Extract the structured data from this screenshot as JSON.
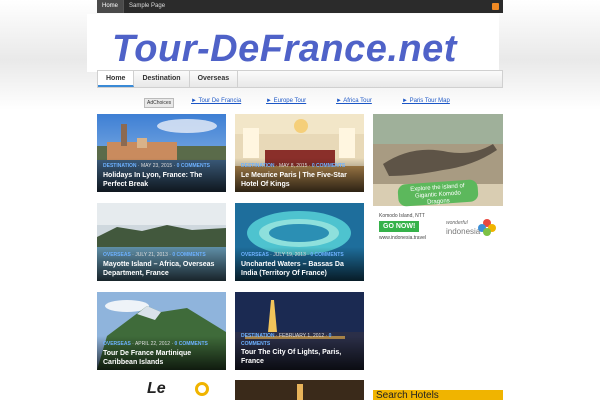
{
  "topbar": {
    "items": [
      {
        "label": "Home"
      },
      {
        "label": "Sample Page"
      }
    ]
  },
  "header": {
    "logo": "Tour-DeFrance.net"
  },
  "nav": {
    "items": [
      {
        "label": "Home"
      },
      {
        "label": "Destination"
      },
      {
        "label": "Overseas"
      }
    ]
  },
  "ad_links": {
    "adchoices": "AdChoices",
    "links": [
      "► Tour De Francia",
      "► Europe Tour",
      "► Africa Tour",
      "► Paris Tour Map"
    ]
  },
  "posts": [
    {
      "category": "DESTINATION",
      "date": "MAY 23, 2015",
      "comments": "0 COMMENTS",
      "title": "Holidays In Lyon, France: The Perfect Break"
    },
    {
      "category": "DESTINATION",
      "date": "MAY 8, 2015",
      "comments": "0 COMMENTS",
      "title": "Le Meurice Paris | The Five-Star Hotel Of Kings"
    },
    {
      "category": "OVERSEAS",
      "date": "JULY 21, 2013",
      "comments": "0 COMMENTS",
      "title": "Mayotte Island – Africa, Overseas Department, France"
    },
    {
      "category": "OVERSEAS",
      "date": "JULY 19, 2013",
      "comments": "0 COMMENTS",
      "title": "Uncharted Waters – Bassas Da India (Territory Of France)"
    },
    {
      "category": "OVERSEAS",
      "date": "APRIL 22, 2012",
      "comments": "0 COMMENTS",
      "title": "Tour De France Martinique Caribbean Islands"
    },
    {
      "category": "DESTINATION",
      "date": "FEBRUARY 1, 2012",
      "comments": "0 COMMENTS",
      "title": "Tour The City Of Lights, Paris, France"
    }
  ],
  "ad": {
    "headline": "Explore the island of Gigantic Komodo Dragons",
    "location": "Komodo Island, NTT",
    "cta": "GO NOW!",
    "url": "www.indonesia.travel",
    "brand_small": "wonderful",
    "brand": "indonesia"
  },
  "bottom_logo": "Le",
  "sidebar": {
    "search_title": "Search Hotels"
  },
  "colors": {
    "logo": "#4f62c8",
    "link": "#1b56c6",
    "accent": "#3a8ad6",
    "search": "#f0b400"
  }
}
